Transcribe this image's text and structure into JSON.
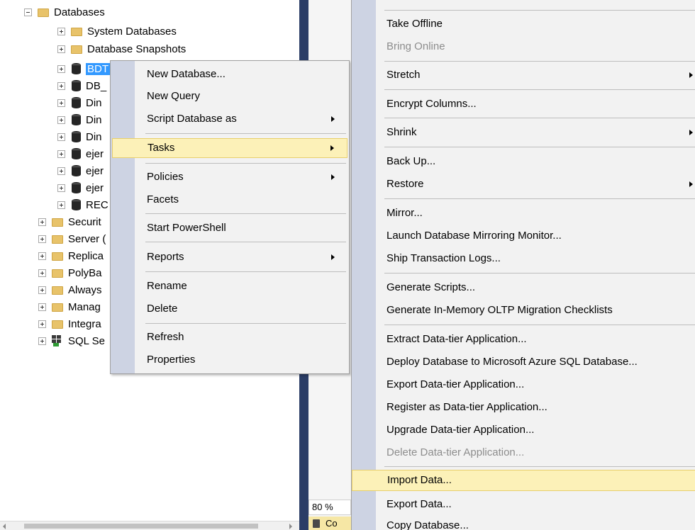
{
  "object_explorer": {
    "nodes": [
      {
        "label": "Databases"
      },
      {
        "label": "System Databases"
      },
      {
        "label": "Database Snapshots"
      },
      {
        "label": "BDT"
      },
      {
        "label": "DB_"
      },
      {
        "label": "Din"
      },
      {
        "label": "Din"
      },
      {
        "label": "Din"
      },
      {
        "label": "ejer"
      },
      {
        "label": "ejer"
      },
      {
        "label": "ejer"
      },
      {
        "label": "REC"
      },
      {
        "label": "Securit"
      },
      {
        "label": "Server ("
      },
      {
        "label": "Replica"
      },
      {
        "label": "PolyBa"
      },
      {
        "label": "Always"
      },
      {
        "label": "Manag"
      },
      {
        "label": "Integra"
      },
      {
        "label": "SQL Se"
      }
    ]
  },
  "zoom": {
    "value": "80 %"
  },
  "status": {
    "text": "Co"
  },
  "context_menu": {
    "items": [
      {
        "label": "New Database..."
      },
      {
        "label": "New Query"
      },
      {
        "label": "Script Database as"
      },
      {
        "label": "Tasks"
      },
      {
        "label": "Policies"
      },
      {
        "label": "Facets"
      },
      {
        "label": "Start PowerShell"
      },
      {
        "label": "Reports"
      },
      {
        "label": "Rename"
      },
      {
        "label": "Delete"
      },
      {
        "label": "Refresh"
      },
      {
        "label": "Properties"
      }
    ]
  },
  "tasks_menu": {
    "items": [
      {
        "label": "Take Offline"
      },
      {
        "label": "Bring Online"
      },
      {
        "label": "Stretch"
      },
      {
        "label": "Encrypt Columns..."
      },
      {
        "label": "Shrink"
      },
      {
        "label": "Back Up..."
      },
      {
        "label": "Restore"
      },
      {
        "label": "Mirror..."
      },
      {
        "label": "Launch Database Mirroring Monitor..."
      },
      {
        "label": "Ship Transaction Logs..."
      },
      {
        "label": "Generate Scripts..."
      },
      {
        "label": "Generate In-Memory OLTP Migration Checklists"
      },
      {
        "label": "Extract Data-tier Application..."
      },
      {
        "label": "Deploy Database to Microsoft Azure SQL Database..."
      },
      {
        "label": "Export Data-tier Application..."
      },
      {
        "label": "Register as Data-tier Application..."
      },
      {
        "label": "Upgrade Data-tier Application..."
      },
      {
        "label": "Delete Data-tier Application..."
      },
      {
        "label": "Import Data..."
      },
      {
        "label": "Export Data..."
      },
      {
        "label": "Copy Database..."
      }
    ]
  },
  "colors": {
    "selection": "#3399ff",
    "menu_highlight": "#fcf1b8",
    "menu_gutter": "#cdd3e3",
    "splitter": "#2b3d66",
    "disabled_text": "#8d8d8d"
  }
}
